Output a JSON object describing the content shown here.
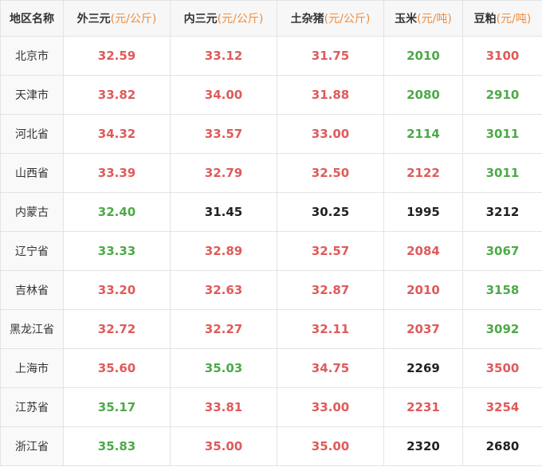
{
  "headers": [
    {
      "name": "地区名称",
      "unit": ""
    },
    {
      "name": "外三元",
      "unit": "(元/公斤)"
    },
    {
      "name": "内三元",
      "unit": "(元/公斤)"
    },
    {
      "name": "土杂猪",
      "unit": "(元/公斤)"
    },
    {
      "name": "玉米",
      "unit": "(元/吨)"
    },
    {
      "name": "豆粕",
      "unit": "(元/吨)"
    }
  ],
  "trend_colors": {
    "up": "#e05a5a",
    "down": "#4caa48",
    "flat": "#222222"
  },
  "rows": [
    {
      "region": "北京市",
      "cells": [
        {
          "value": "32.59",
          "trend": "up"
        },
        {
          "value": "33.12",
          "trend": "up"
        },
        {
          "value": "31.75",
          "trend": "up"
        },
        {
          "value": "2010",
          "trend": "down"
        },
        {
          "value": "3100",
          "trend": "up"
        }
      ]
    },
    {
      "region": "天津市",
      "cells": [
        {
          "value": "33.82",
          "trend": "up"
        },
        {
          "value": "34.00",
          "trend": "up"
        },
        {
          "value": "31.88",
          "trend": "up"
        },
        {
          "value": "2080",
          "trend": "down"
        },
        {
          "value": "2910",
          "trend": "down"
        }
      ]
    },
    {
      "region": "河北省",
      "cells": [
        {
          "value": "34.32",
          "trend": "up"
        },
        {
          "value": "33.57",
          "trend": "up"
        },
        {
          "value": "33.00",
          "trend": "up"
        },
        {
          "value": "2114",
          "trend": "down"
        },
        {
          "value": "3011",
          "trend": "down"
        }
      ]
    },
    {
      "region": "山西省",
      "cells": [
        {
          "value": "33.39",
          "trend": "up"
        },
        {
          "value": "32.79",
          "trend": "up"
        },
        {
          "value": "32.50",
          "trend": "up"
        },
        {
          "value": "2122",
          "trend": "up"
        },
        {
          "value": "3011",
          "trend": "down"
        }
      ]
    },
    {
      "region": "内蒙古",
      "cells": [
        {
          "value": "32.40",
          "trend": "down"
        },
        {
          "value": "31.45",
          "trend": "flat"
        },
        {
          "value": "30.25",
          "trend": "flat"
        },
        {
          "value": "1995",
          "trend": "flat"
        },
        {
          "value": "3212",
          "trend": "flat"
        }
      ]
    },
    {
      "region": "辽宁省",
      "cells": [
        {
          "value": "33.33",
          "trend": "down"
        },
        {
          "value": "32.89",
          "trend": "up"
        },
        {
          "value": "32.57",
          "trend": "up"
        },
        {
          "value": "2084",
          "trend": "up"
        },
        {
          "value": "3067",
          "trend": "down"
        }
      ]
    },
    {
      "region": "吉林省",
      "cells": [
        {
          "value": "33.20",
          "trend": "up"
        },
        {
          "value": "32.63",
          "trend": "up"
        },
        {
          "value": "32.87",
          "trend": "up"
        },
        {
          "value": "2010",
          "trend": "up"
        },
        {
          "value": "3158",
          "trend": "down"
        }
      ]
    },
    {
      "region": "黑龙江省",
      "cells": [
        {
          "value": "32.72",
          "trend": "up"
        },
        {
          "value": "32.27",
          "trend": "up"
        },
        {
          "value": "32.11",
          "trend": "up"
        },
        {
          "value": "2037",
          "trend": "up"
        },
        {
          "value": "3092",
          "trend": "down"
        }
      ]
    },
    {
      "region": "上海市",
      "cells": [
        {
          "value": "35.60",
          "trend": "up"
        },
        {
          "value": "35.03",
          "trend": "down"
        },
        {
          "value": "34.75",
          "trend": "up"
        },
        {
          "value": "2269",
          "trend": "flat"
        },
        {
          "value": "3500",
          "trend": "up"
        }
      ]
    },
    {
      "region": "江苏省",
      "cells": [
        {
          "value": "35.17",
          "trend": "down"
        },
        {
          "value": "33.81",
          "trend": "up"
        },
        {
          "value": "33.00",
          "trend": "up"
        },
        {
          "value": "2231",
          "trend": "up"
        },
        {
          "value": "3254",
          "trend": "up"
        }
      ]
    },
    {
      "region": "浙江省",
      "cells": [
        {
          "value": "35.83",
          "trend": "down"
        },
        {
          "value": "35.00",
          "trend": "up"
        },
        {
          "value": "35.00",
          "trend": "up"
        },
        {
          "value": "2320",
          "trend": "flat"
        },
        {
          "value": "2680",
          "trend": "flat"
        }
      ]
    }
  ]
}
